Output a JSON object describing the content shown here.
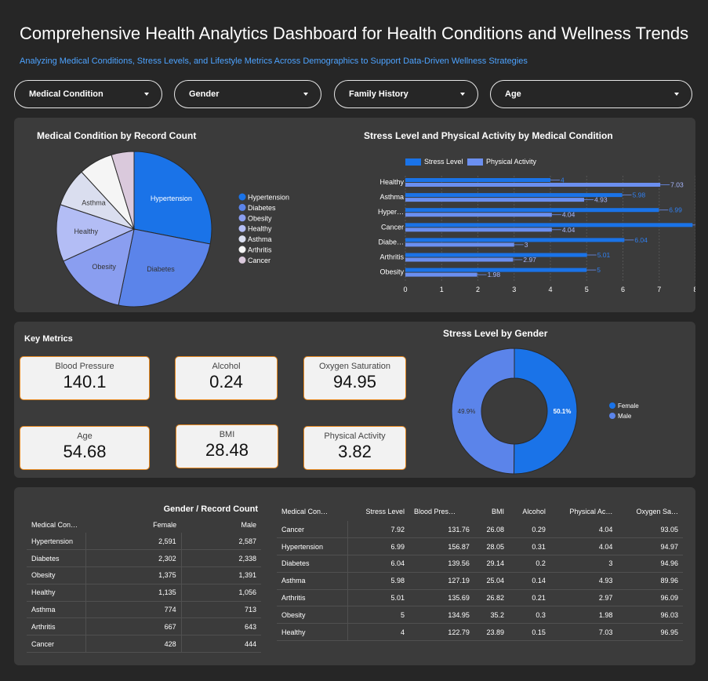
{
  "header": {
    "title": "Comprehensive Health Analytics Dashboard for Health Conditions and Wellness Trends",
    "subtitle": "Analyzing Medical Conditions, Stress Levels, and Lifestyle Metrics Across Demographics to Support Data-Driven Wellness Strategies"
  },
  "filters": [
    {
      "label": "Medical Condition"
    },
    {
      "label": "Gender"
    },
    {
      "label": "Family History"
    },
    {
      "label": "Age"
    }
  ],
  "colors": {
    "background": "#262626",
    "panel": "#3b3b3b",
    "accent_blue": "#1a73e8",
    "accent_light_blue": "#6b8ff0",
    "subtitle": "#4da3ff",
    "kpi_border": "#e8891f"
  },
  "icons": {
    "dropdown": "chevron-down-icon"
  },
  "pie_panel": {
    "title": "Medical Condition by Record Count"
  },
  "bar_panel": {
    "title": "Stress Level and Physical Activity by Medical Condition"
  },
  "kpi_panel": {
    "title": "Key Metrics",
    "cards": [
      {
        "label": "Blood Pressure",
        "value": "140.1"
      },
      {
        "label": "Alcohol",
        "value": "0.24"
      },
      {
        "label": "Oxygen Saturation",
        "value": "94.95"
      },
      {
        "label": "Age",
        "value": "54.68"
      },
      {
        "label": "BMI",
        "value": "28.48"
      },
      {
        "label": "Physical Activity",
        "value": "3.82"
      }
    ]
  },
  "donut_panel": {
    "title": "Stress Level by Gender"
  },
  "chart_data": [
    {
      "type": "pie",
      "title": "Medical Condition by Record Count",
      "categories": [
        "Hypertension",
        "Diabetes",
        "Obesity",
        "Healthy",
        "Asthma",
        "Arthritis",
        "Cancer"
      ],
      "values": [
        5178,
        4640,
        2766,
        2191,
        1487,
        1310,
        872
      ],
      "colors": [
        "#1a73e8",
        "#5b84ea",
        "#8a9ef0",
        "#b3bdf5",
        "#dadeef",
        "#f5f5f5",
        "#dac9dc"
      ],
      "legend": "right"
    },
    {
      "type": "bar",
      "orientation": "horizontal",
      "title": "Stress Level and Physical Activity by Medical Condition",
      "categories": [
        "Healthy",
        "Asthma",
        "Hyper…",
        "Cancer",
        "Diabe…",
        "Arthritis",
        "Obesity"
      ],
      "series": [
        {
          "name": "Stress Level",
          "values": [
            4,
            5.98,
            6.99,
            7.92,
            6.04,
            5.01,
            5
          ],
          "labels": [
            "4",
            "5.98",
            "6.99",
            "7.92",
            "6.04",
            "5.01",
            "5"
          ],
          "color": "#1a73e8"
        },
        {
          "name": "Physical Activity",
          "values": [
            7.03,
            4.93,
            4.04,
            4.04,
            3,
            2.97,
            1.98
          ],
          "labels": [
            "7.03",
            "4.93",
            "4.04",
            "4.04",
            "3",
            "2.97",
            "1.98"
          ],
          "color": "#6b8ff0"
        }
      ],
      "xlim": [
        0,
        8
      ],
      "xticks": [
        "0",
        "1",
        "2",
        "3",
        "4",
        "5",
        "6",
        "7",
        "8"
      ],
      "grid": true,
      "legend": "top-left"
    },
    {
      "type": "pie",
      "donut": true,
      "title": "Stress Level by Gender",
      "categories": [
        "Female",
        "Male"
      ],
      "values": [
        50.1,
        49.9
      ],
      "labels": [
        "50.1%",
        "49.9%"
      ],
      "colors": [
        "#1a73e8",
        "#5b84ea"
      ],
      "legend": "right"
    },
    {
      "type": "table",
      "title": "Gender / Record Count",
      "columns": [
        "Medical Con…",
        "Female",
        "Male"
      ],
      "rows": [
        [
          "Hypertension",
          "2,591",
          "2,587"
        ],
        [
          "Diabetes",
          "2,302",
          "2,338"
        ],
        [
          "Obesity",
          "1,375",
          "1,391"
        ],
        [
          "Healthy",
          "1,135",
          "1,056"
        ],
        [
          "Asthma",
          "774",
          "713"
        ],
        [
          "Arthritis",
          "667",
          "643"
        ],
        [
          "Cancer",
          "428",
          "444"
        ]
      ]
    },
    {
      "type": "table",
      "columns": [
        "Medical Con…",
        "Stress Level",
        "Blood Pres…",
        "BMI",
        "Alcohol",
        "Physical Ac…",
        "Oxygen Sa…"
      ],
      "rows": [
        [
          "Cancer",
          "7.92",
          "131.76",
          "26.08",
          "0.29",
          "4.04",
          "93.05"
        ],
        [
          "Hypertension",
          "6.99",
          "156.87",
          "28.05",
          "0.31",
          "4.04",
          "94.97"
        ],
        [
          "Diabetes",
          "6.04",
          "139.56",
          "29.14",
          "0.2",
          "3",
          "94.96"
        ],
        [
          "Asthma",
          "5.98",
          "127.19",
          "25.04",
          "0.14",
          "4.93",
          "89.96"
        ],
        [
          "Arthritis",
          "5.01",
          "135.69",
          "26.82",
          "0.21",
          "2.97",
          "96.09"
        ],
        [
          "Obesity",
          "5",
          "134.95",
          "35.2",
          "0.3",
          "1.98",
          "96.03"
        ],
        [
          "Healthy",
          "4",
          "122.79",
          "23.89",
          "0.15",
          "7.03",
          "96.95"
        ]
      ]
    }
  ]
}
